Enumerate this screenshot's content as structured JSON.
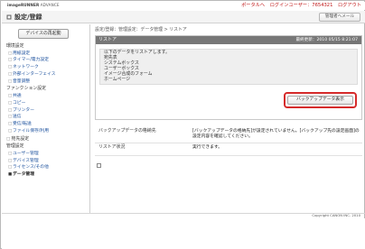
{
  "header": {
    "logo_brand": "imageRUNNER",
    "logo_suffix": " ADVANCE",
    "portal_link": "ポータルへ",
    "login_user": "ログインユーザー：7654321",
    "logout_link": "ログアウト",
    "page_title": "設定/登録",
    "email_button": "管理者へメール"
  },
  "sidebar": {
    "restart_button": "デバイスの再起動",
    "sections": [
      {
        "label": "環境設定",
        "items": [
          {
            "label": "用紙設定"
          },
          {
            "label": "タイマー/電力設定"
          },
          {
            "label": "ネットワーク"
          },
          {
            "label": "外部インターフェイス"
          },
          {
            "label": "音量調整"
          }
        ]
      },
      {
        "label": "ファンクション設定",
        "items": [
          {
            "label": "共通"
          },
          {
            "label": "コピー"
          },
          {
            "label": "プリンター"
          },
          {
            "label": "送信"
          },
          {
            "label": "受信/転送"
          },
          {
            "label": "ファイル保存/利用"
          }
        ]
      },
      {
        "label": "宛先設定",
        "items": []
      },
      {
        "label": "管理設定",
        "items": [
          {
            "label": "ユーザー管理"
          },
          {
            "label": "デバイス管理"
          },
          {
            "label": "ライセンス/その他"
          },
          {
            "label": "データ管理",
            "active": true
          }
        ]
      }
    ]
  },
  "main": {
    "breadcrumb": "設定/登録：管理設定：データ管理 > リストア",
    "panel": {
      "title": "リストア",
      "updated": "最終更新：2010 05/15 8:21:07",
      "info_lines": [
        "以下のデータをリストアします。",
        "宛先表",
        "システムボックス",
        "ユーザーボックス",
        "イメージ合成のフォーム",
        "ホームページ"
      ],
      "backup_button": "バックアップデータ表示"
    },
    "details": [
      {
        "label": "バックアップデータの格納先",
        "value": "[バックアップデータの格納先]が設定されていません。[バックアップ先の設定画面]の設定内容を確認してください。"
      },
      {
        "label": "リストア状況",
        "value": "実行できます。"
      }
    ]
  },
  "footer": {
    "copyright": "Copyright CANON INC. 2010"
  },
  "colors": {
    "accent_red": "#c01515",
    "highlight_border": "#d62b2b",
    "panel_header": "#777777",
    "link_blue": "#1a4f9c"
  }
}
